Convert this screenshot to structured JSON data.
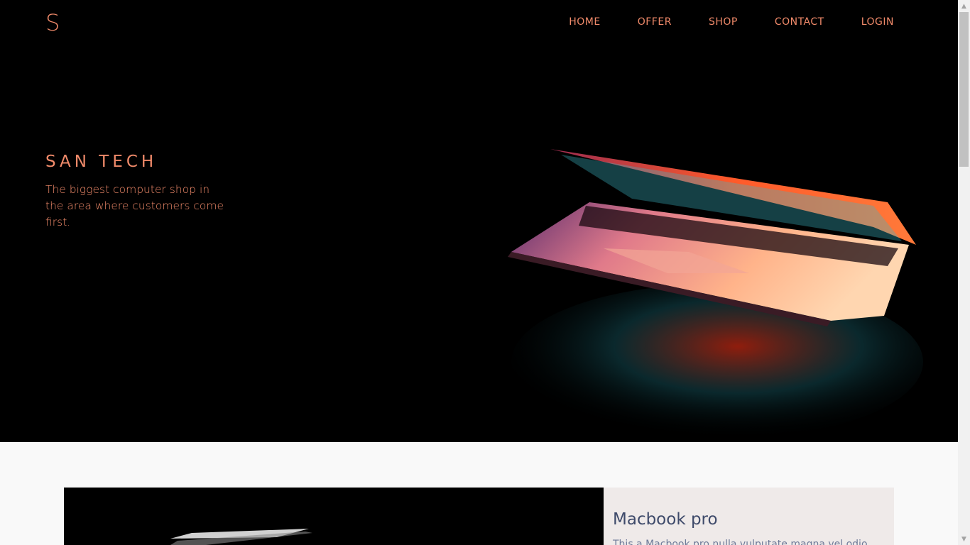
{
  "brand": {
    "logo": "S"
  },
  "nav": {
    "items": [
      "HOME",
      "OFFER",
      "SHOP",
      "CONTACT",
      "LOGIN"
    ]
  },
  "hero": {
    "title": "SAN TECH",
    "subtitle": "The biggest computer shop in the area where customers come first."
  },
  "product": {
    "title": "Macbook pro",
    "description": "This a Macbook pro nulla vulputate magna vel odio"
  },
  "colors": {
    "accent": "#f08a6a",
    "hero_bg": "#000000",
    "card_bg": "#efeae9",
    "product_title": "#3e4a6a"
  }
}
